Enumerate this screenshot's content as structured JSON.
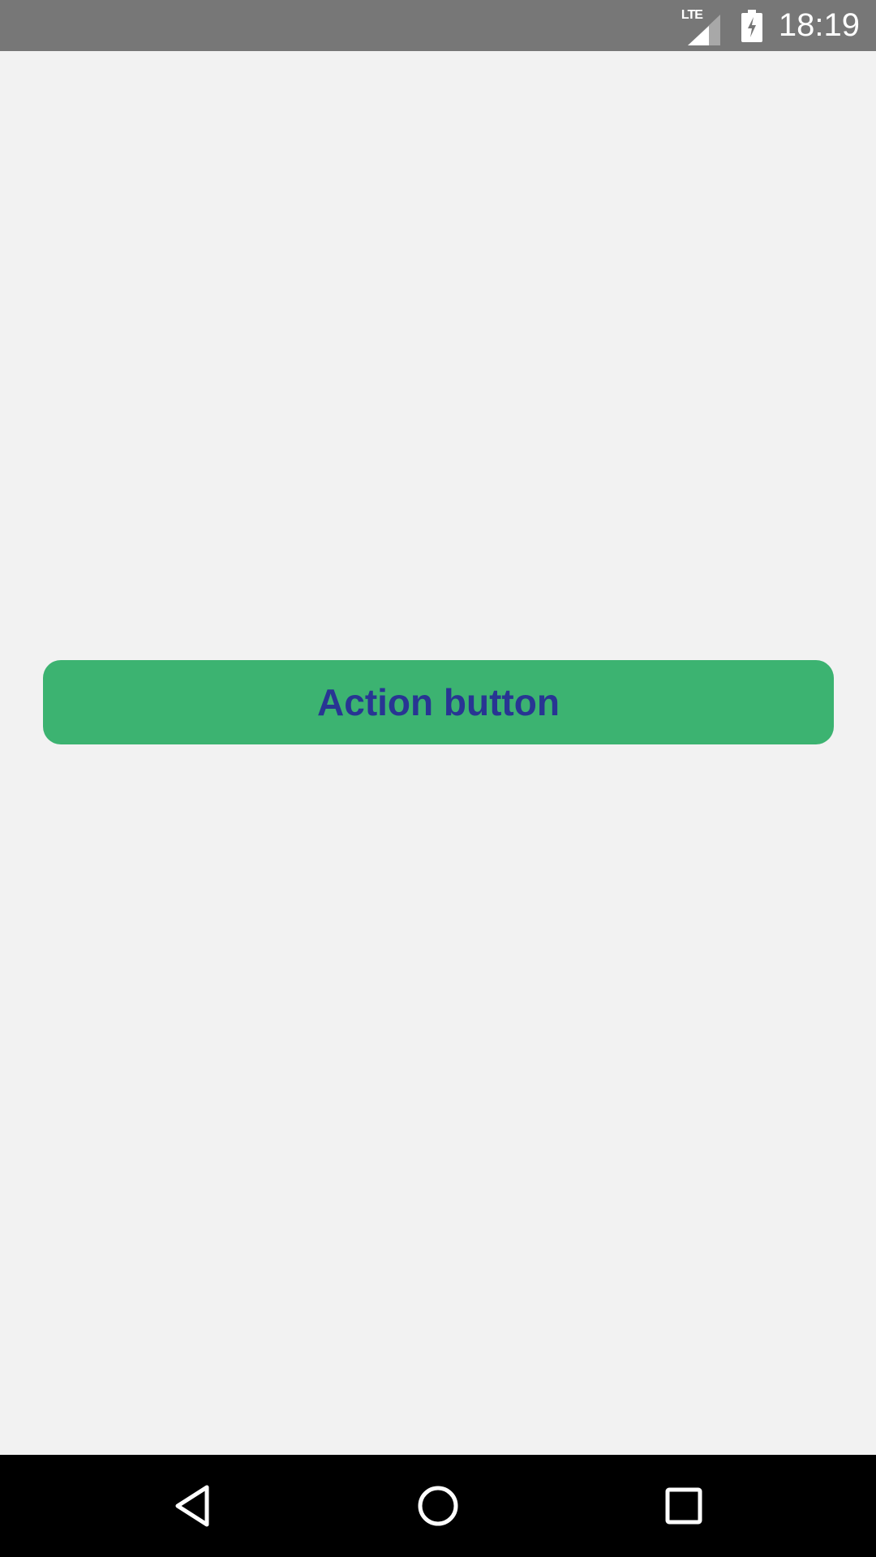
{
  "status_bar": {
    "network_label": "LTE",
    "network_icon": "signal-icon",
    "battery_icon": "battery-charging-icon",
    "time": "18:19"
  },
  "main": {
    "action_button_label": "Action button"
  },
  "navigation_bar": {
    "back_icon": "back-icon",
    "home_icon": "home-icon",
    "recents_icon": "recents-icon"
  },
  "colors": {
    "status_bar_bg": "#777777",
    "page_bg": "#f2f2f2",
    "button_bg": "#3cb371",
    "button_text": "#283593",
    "nav_bar_bg": "#000000"
  }
}
